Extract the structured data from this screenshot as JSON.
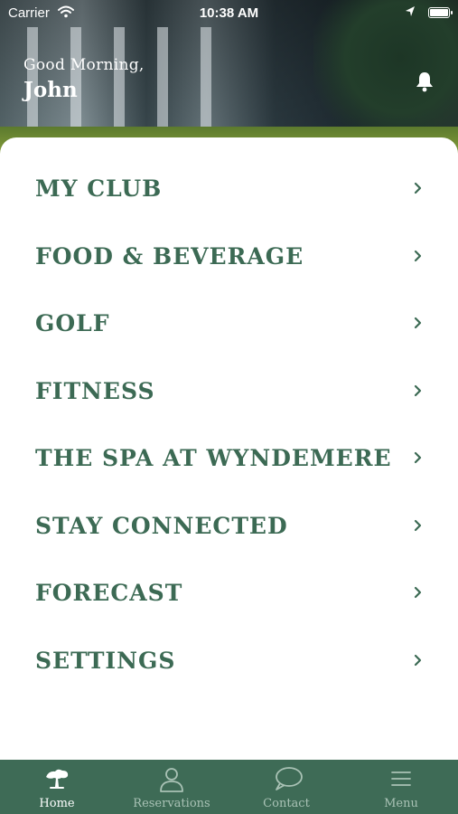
{
  "status_bar": {
    "carrier": "Carrier",
    "time": "10:38 AM"
  },
  "header": {
    "greeting": "Good Morning,",
    "user_name": "John"
  },
  "menu": [
    {
      "label": "MY CLUB"
    },
    {
      "label": "FOOD & BEVERAGE"
    },
    {
      "label": "GOLF"
    },
    {
      "label": "FITNESS"
    },
    {
      "label": "THE SPA AT WYNDEMERE"
    },
    {
      "label": "STAY CONNECTED"
    },
    {
      "label": "FORECAST"
    },
    {
      "label": "SETTINGS"
    }
  ],
  "tabbar": {
    "tabs": [
      {
        "label": "Home",
        "icon": "tree-icon",
        "active": true
      },
      {
        "label": "Reservations",
        "icon": "person-icon",
        "active": false
      },
      {
        "label": "Contact",
        "icon": "chat-bubble-icon",
        "active": false
      },
      {
        "label": "Menu",
        "icon": "hamburger-icon",
        "active": false
      }
    ]
  },
  "colors": {
    "accent_green": "#3c6a54",
    "tabbar_bg": "#3e6b56",
    "tab_inactive": "#a9c2b5",
    "tab_active": "#ffffff"
  }
}
